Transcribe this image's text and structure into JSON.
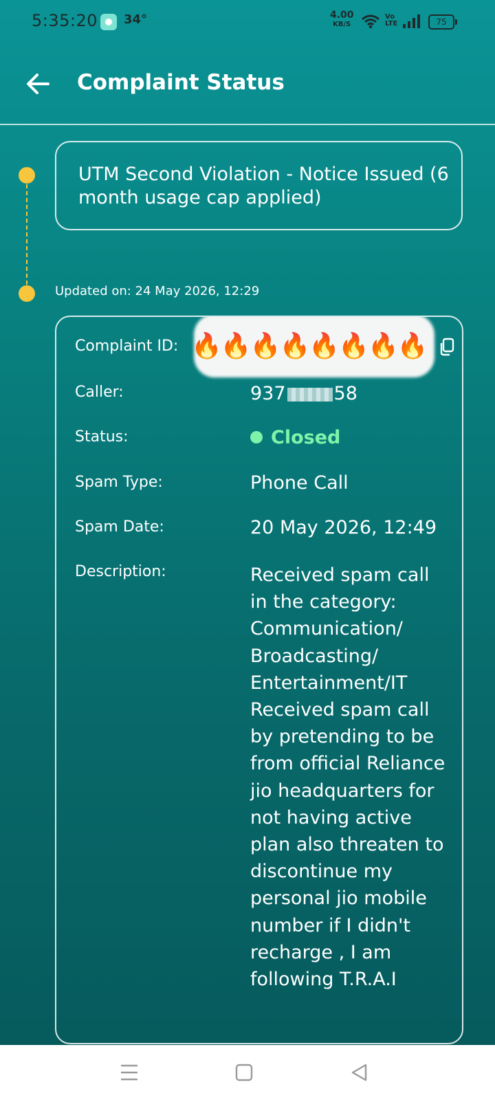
{
  "status_bar": {
    "time": "5:35:20",
    "temperature": "34°",
    "net_speed": "4.00",
    "net_unit": "KB/S",
    "volte_top": "Vo",
    "volte_bottom": "LTE",
    "battery": "75"
  },
  "header": {
    "title": "Complaint Status",
    "back_icon": "arrow-left-icon"
  },
  "timeline": {
    "status_title": "UTM Second Violation - Notice Issued (6 month usage cap applied)",
    "updated_on": "Updated on: 24 May 2026, 12:29"
  },
  "details": {
    "complaint_id_label": "Complaint ID:",
    "complaint_id_value": "🔥🔥🔥🔥🔥🔥🔥🔥",
    "caller_label": "Caller:",
    "caller_prefix": "937",
    "caller_suffix": "58",
    "status_label": "Status:",
    "status_value": "Closed",
    "spam_type_label": "Spam Type:",
    "spam_type_value": "Phone Call",
    "spam_date_label": "Spam Date:",
    "spam_date_value": "20 May 2026, 12:49",
    "description_label": "Description:",
    "description_value": "Received spam call in the category: Communication/ Broadcasting/ Entertainment/IT Received spam call by pretending to be from official Reliance jio headquarters  for not having active plan  also threaten to discontinue my personal jio mobile number if I didn't recharge , I am following T.R.A.I"
  },
  "colors": {
    "accent": "#0b9496",
    "timeline_dot": "#f7c63d",
    "status_closed": "#7ff3a9"
  },
  "nav": {
    "menu_icon": "menu-icon",
    "home_icon": "home-square-icon",
    "back_icon": "back-triangle-icon"
  }
}
